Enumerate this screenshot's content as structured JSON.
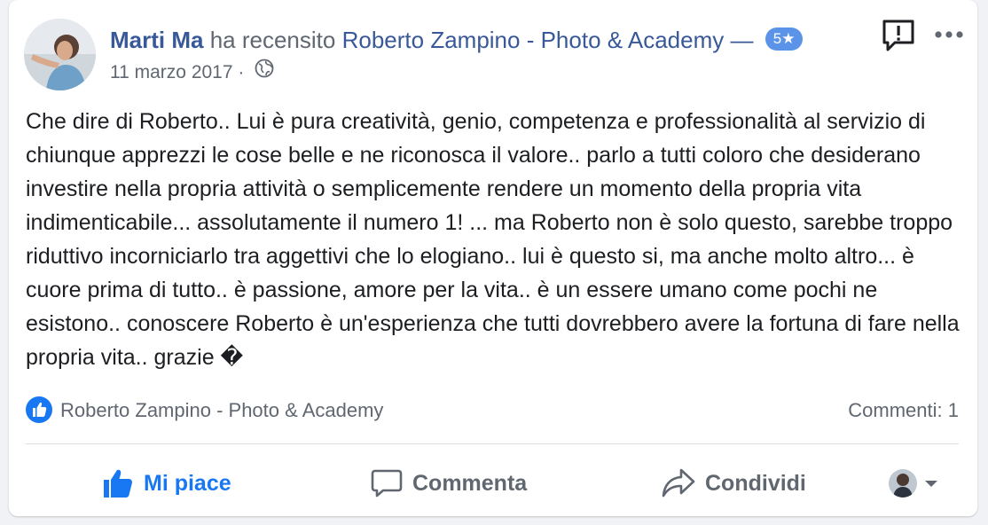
{
  "review": {
    "author": "Marti Ma",
    "verb": "ha recensito",
    "page_name": "Roberto Zampino - Photo & Academy",
    "dash": "—",
    "rating": "5",
    "star": "★",
    "date": "11 marzo 2017",
    "separator": "·",
    "text": "Che dire di Roberto.. Lui è pura creatività, genio, competenza e professionalità al servizio di chiunque apprezzi le cose belle e ne riconosca il valore.. parlo a tutti coloro che desiderano investire nella propria attività o semplicemente rendere un momento della propria vita indimenticabile... assolutamente il numero 1! ... ma Roberto non è solo questo, sarebbe troppo riduttivo incorniciarlo tra aggettivi che lo elogiano.. lui è questo si, ma anche molto altro... è cuore prima di tutto.. è passione, amore per la vita.. è un essere umano come pochi ne esistono.. conoscere Roberto è un'esperienza che tutti dovrebbero avere la fortuna di fare nella propria vita.. grazie �"
  },
  "stats": {
    "reactor_name": "Roberto Zampino - Photo & Academy",
    "comments": "Commenti: 1"
  },
  "actions": {
    "like": "Mi piace",
    "comment": "Commenta",
    "share": "Condividi"
  },
  "icons": {
    "privacy": "globe-icon",
    "report": "report-icon",
    "more": "more-icon",
    "like": "thumbs-up-icon",
    "comment": "comment-icon",
    "share": "share-icon",
    "audience": "chevron-down-icon"
  },
  "colors": {
    "link": "#385898",
    "accent": "#1877f2",
    "rating_badge": "#5b93e8",
    "secondary_text": "#606770"
  }
}
